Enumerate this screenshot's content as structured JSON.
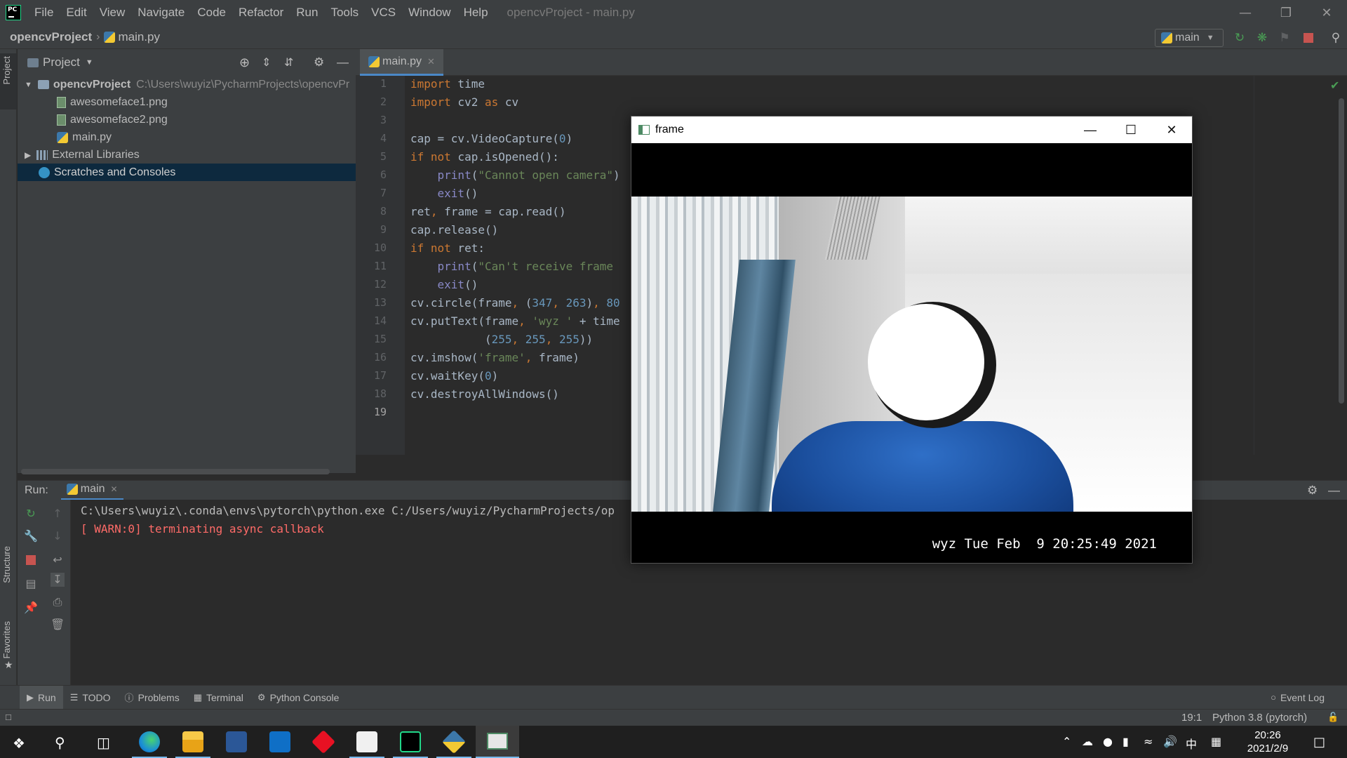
{
  "menubar": {
    "items": [
      "File",
      "Edit",
      "View",
      "Navigate",
      "Code",
      "Refactor",
      "Run",
      "Tools",
      "VCS",
      "Window",
      "Help"
    ],
    "window_title": "opencvProject - main.py"
  },
  "navbar": {
    "project": "opencvProject",
    "file": "main.py",
    "run_config": "main"
  },
  "left_stripe": {
    "project_tab": "Project",
    "structure_tab": "Structure",
    "favorites_tab": "Favorites"
  },
  "project_panel": {
    "title": "Project",
    "root_name": "opencvProject",
    "root_path": "C:\\Users\\wuyiz\\PycharmProjects\\opencvPr",
    "files": [
      "awesomeface1.png",
      "awesomeface2.png",
      "main.py"
    ],
    "external_libraries": "External Libraries",
    "scratches": "Scratches and Consoles"
  },
  "editor": {
    "tab_label": "main.py",
    "line_numbers": [
      "1",
      "2",
      "3",
      "4",
      "5",
      "6",
      "7",
      "8",
      "9",
      "10",
      "11",
      "12",
      "13",
      "14",
      "15",
      "16",
      "17",
      "18",
      "19"
    ],
    "current_line": "19"
  },
  "run_panel": {
    "label": "Run:",
    "tab": "main",
    "console_line1": "C:\\Users\\wuyiz\\.conda\\envs\\pytorch\\python.exe C:/Users/wuyiz/PycharmProjects/op",
    "console_line2": "[ WARN:0] terminating async callback"
  },
  "bottom_tabs": [
    "Run",
    "TODO",
    "Problems",
    "Terminal",
    "Python Console"
  ],
  "event_log": "Event Log",
  "statusbar": {
    "position": "19:1",
    "interpreter": "Python 3.8 (pytorch)"
  },
  "cv_window": {
    "title": "frame",
    "overlay_text": "wyz Tue Feb  9 20:25:49 2021"
  },
  "taskbar": {
    "time": "20:26",
    "date": "2021/2/9",
    "ime": "中"
  },
  "colors": {
    "accent": "#4a88c7",
    "keyword": "#cc7832",
    "number": "#6897bb",
    "string": "#6a8759",
    "warn": "#ff6b68"
  }
}
